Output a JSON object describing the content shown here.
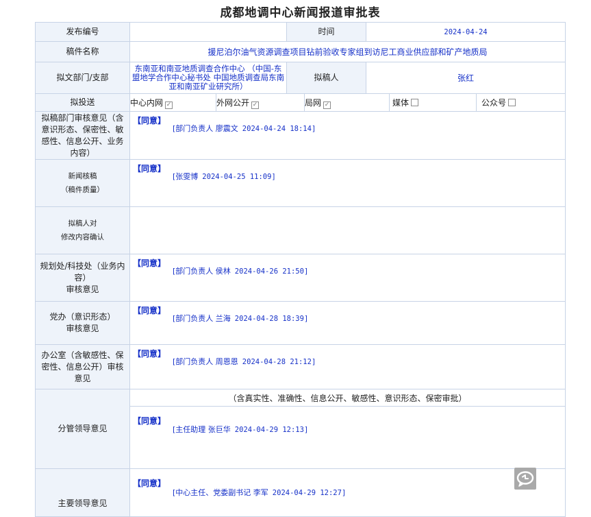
{
  "page": {
    "title": "成都地调中心新闻报道审批表"
  },
  "form": {
    "publish_no": {
      "label": "发布编号",
      "value": ""
    },
    "time": {
      "label": "时间",
      "value": "2024-04-24"
    },
    "manuscript_name": {
      "label": "稿件名称",
      "value": "援尼泊尔油气资源调查项目钻前验收专家组到访尼工商业供应部和矿产地质局"
    },
    "drafting_dept": {
      "label": "拟文部门/支部",
      "value": "东南亚和南亚地质调查合作中心 （中国-东盟地学合作中心秘书处 中国地质调查局东南亚和南亚矿业研究所）"
    },
    "drafter": {
      "label": "拟稿人",
      "value": "张红"
    },
    "send_to": {
      "label": "拟投送",
      "channels": [
        {
          "name": "中心内网",
          "checked": true
        },
        {
          "name": "外网公开",
          "checked": true
        },
        {
          "name": "局网",
          "checked": true
        },
        {
          "name": "媒体",
          "checked": false
        },
        {
          "name": "公众号",
          "checked": false
        }
      ]
    }
  },
  "reviews": [
    {
      "label": "拟稿部门审核意见（含意识形态、保密性、敏感性、信息公开、业务内容）",
      "agree": "【同意】",
      "signer": "[部门负责人 廖震文",
      "date": "2024-04-24 18:14]"
    },
    {
      "label_line1": "新闻核稿",
      "label_line2": "（稿件质量）",
      "agree": "【同意】",
      "signer": "[张雯博",
      "date": "2024-04-25 11:09]"
    },
    {
      "label_line1": "拟稿人对",
      "label_line2": "修改内容确认"
    },
    {
      "label_line1": "规划处/科技处（业务内容）",
      "label_line2": "审核意见",
      "agree": "【同意】",
      "signer": "[部门负责人 侯林",
      "date": "2024-04-26 21:50]"
    },
    {
      "label_line1": "党办（意识形态）",
      "label_line2": "审核意见",
      "agree": "【同意】",
      "signer": "[部门负责人 兰海",
      "date": "2024-04-28 18:39]"
    },
    {
      "label": "办公室（含敏感性、保密性、信息公开）审核意见",
      "agree": "【同意】",
      "signer": "[部门负责人 周恩恩",
      "date": "2024-04-28 21:12]"
    }
  ],
  "leader_review": {
    "label": "分管领导意见",
    "note": "（含真实性、准确性、信息公开、敏感性、意识形态、保密审批）",
    "agree": "【同意】",
    "signer": "[主任助理 张巨华",
    "date": "2024-04-29 12:13]"
  },
  "main_leader_review": {
    "label": "主要领导意见",
    "agree": "【同意】",
    "signer": "[中心主任、党委副书记 李军",
    "date": "2024-04-29 12:27]"
  },
  "icons": {
    "chat": "chat-bubble-icon",
    "check": "checkmark-icon"
  }
}
